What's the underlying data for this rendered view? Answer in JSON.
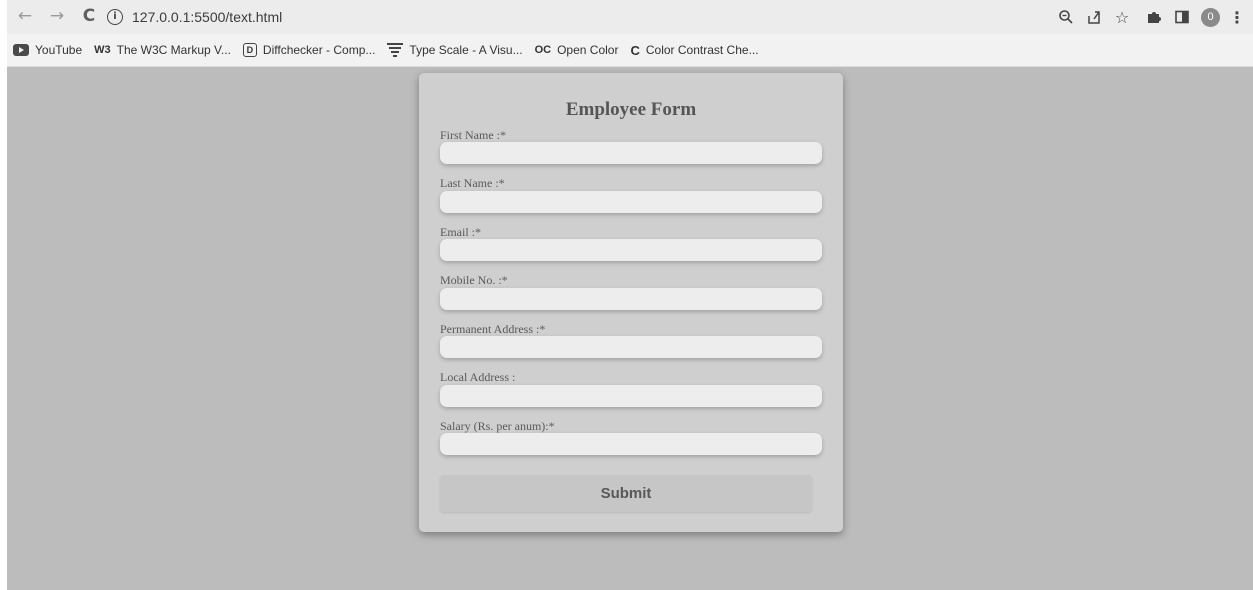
{
  "browser": {
    "url": "127.0.0.1:5500/text.html",
    "nav": {
      "back_icon": "←",
      "forward_icon": "→",
      "reload_icon": "C"
    },
    "profile_initial": "0"
  },
  "bookmarks": [
    {
      "label": "YouTube",
      "icon": "youtube-icon"
    },
    {
      "label": "The W3C Markup V...",
      "icon": "w3c-icon",
      "icon_text": "W3"
    },
    {
      "label": "Diffchecker - Comp...",
      "icon": "diffchecker-icon",
      "icon_text": "D"
    },
    {
      "label": "Type Scale - A Visu...",
      "icon": "type-scale-icon"
    },
    {
      "label": "Open Color",
      "icon": "open-color-icon",
      "icon_text": "OC"
    },
    {
      "label": "Color Contrast Che...",
      "icon": "color-contrast-icon",
      "icon_text": "C"
    }
  ],
  "form": {
    "title": "Employee Form",
    "fields": [
      {
        "label": "First Name :*",
        "value": ""
      },
      {
        "label": "Last Name :*",
        "value": ""
      },
      {
        "label": "Email :*",
        "value": ""
      },
      {
        "label": "Mobile No. :*",
        "value": ""
      },
      {
        "label": "Permanent Address :*",
        "value": ""
      },
      {
        "label": "Local Address :",
        "value": ""
      },
      {
        "label": "Salary (Rs. per anum):*",
        "value": ""
      }
    ],
    "submit_label": "Submit"
  },
  "colors": {
    "page_background": "#bcbcbc",
    "card_background": "#cfcfcf",
    "input_background": "#ededed",
    "button_background": "#c6c6c6"
  }
}
